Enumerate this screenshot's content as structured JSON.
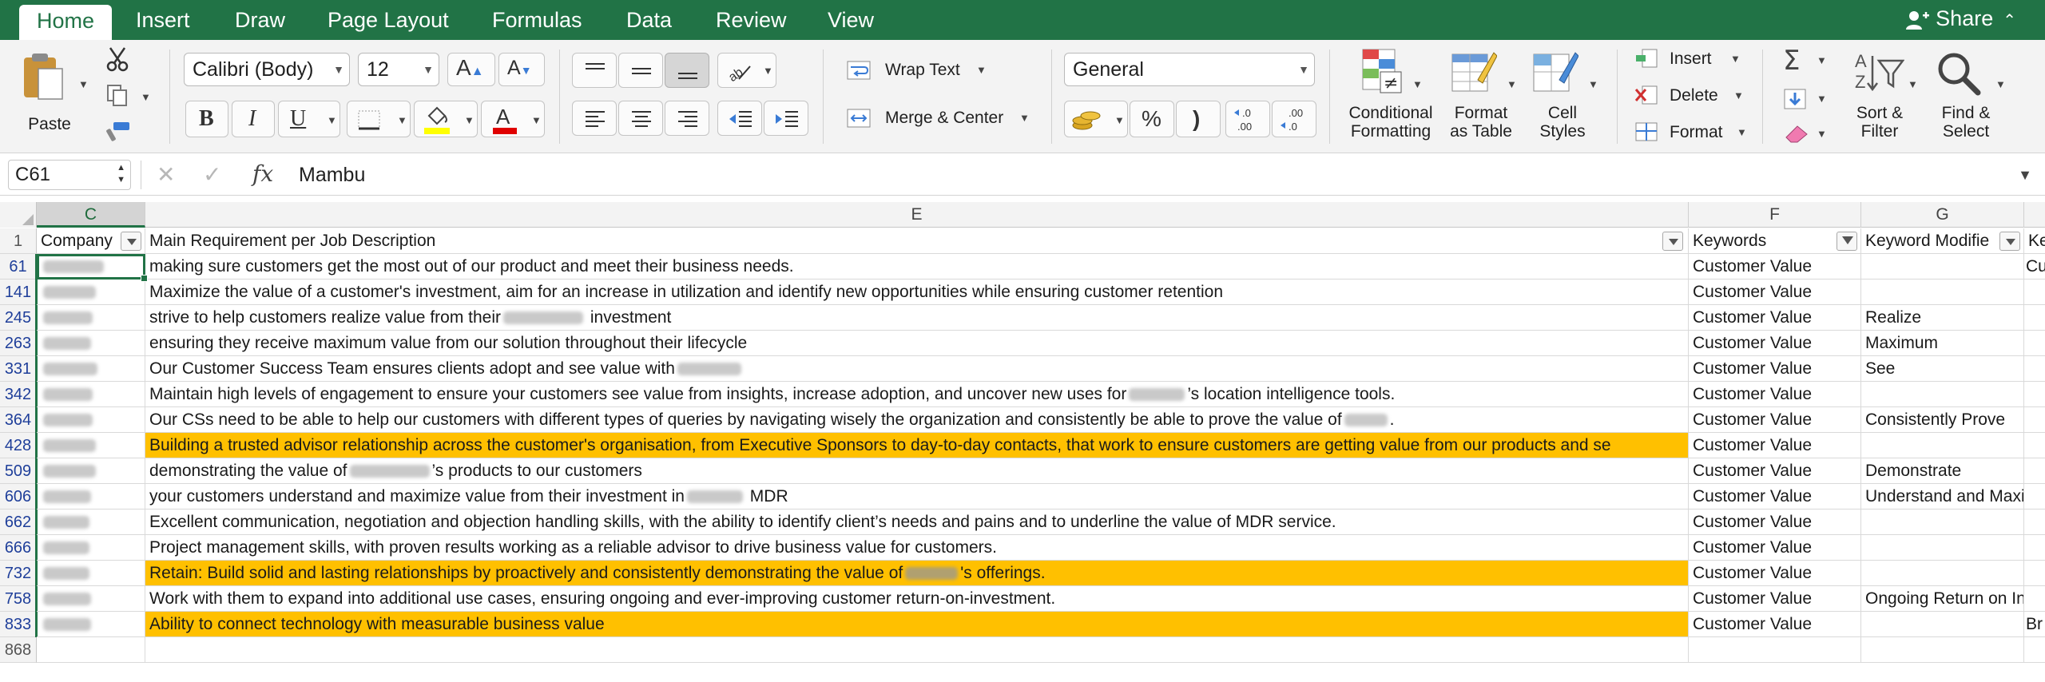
{
  "tabs": [
    {
      "label": "Home",
      "active": true
    },
    {
      "label": "Insert"
    },
    {
      "label": "Draw"
    },
    {
      "label": "Page Layout"
    },
    {
      "label": "Formulas"
    },
    {
      "label": "Data"
    },
    {
      "label": "Review"
    },
    {
      "label": "View"
    }
  ],
  "share_label": "Share",
  "ribbon": {
    "paste_label": "Paste",
    "font_name": "Calibri (Body)",
    "font_size": "12",
    "bold": "B",
    "italic": "I",
    "underline": "U",
    "wrap_text": "Wrap Text",
    "merge_center": "Merge & Center",
    "number_format": "General",
    "percent": "%",
    "comma": ")",
    "inc_decimal": ".0\n.00",
    "conditional_formatting": [
      "Conditional",
      "Formatting"
    ],
    "format_as_table": [
      "Format",
      "as Table"
    ],
    "cell_styles": [
      "Cell",
      "Styles"
    ],
    "insert": "Insert",
    "delete": "Delete",
    "format": "Format",
    "sort_filter": [
      "Sort &",
      "Filter"
    ],
    "find_select": [
      "Find &",
      "Select"
    ],
    "highlight_color": "#ffff00",
    "font_color": "#e00000"
  },
  "formula_bar": {
    "name_box": "C61",
    "fx": "fx",
    "content": "Mambu"
  },
  "columns": {
    "C": "C",
    "E": "E",
    "F": "F",
    "G": "G"
  },
  "headers": {
    "row_num": "1",
    "company": "Company",
    "requirement": "Main Requirement per Job Description",
    "keywords": "Keywords",
    "modifier": "Keyword Modifie",
    "next": "Ke"
  },
  "rows": [
    {
      "num": "61",
      "req_parts": [
        "making sure customers get the most out of our product and meet their business needs."
      ],
      "keywords": "Customer Value",
      "modifier": "",
      "next": "Cu",
      "highlight": false
    },
    {
      "num": "141",
      "req_parts": [
        "Maximize the value of a customer's investment, aim for an increase in utilization and identify new opportunities while ensuring customer retention"
      ],
      "keywords": "Customer Value",
      "modifier": "",
      "next": "",
      "highlight": false
    },
    {
      "num": "245",
      "req_parts": [
        "strive to help customers realize value from their",
        " investment"
      ],
      "keywords": "Customer Value",
      "modifier": "Realize",
      "next": "",
      "highlight": false
    },
    {
      "num": "263",
      "req_parts": [
        "ensuring they receive maximum value from our solution throughout their lifecycle"
      ],
      "keywords": "Customer Value",
      "modifier": "Maximum",
      "next": "",
      "highlight": false
    },
    {
      "num": "331",
      "req_parts": [
        "Our Customer Success Team ensures clients adopt and see value with",
        ""
      ],
      "keywords": "Customer Value",
      "modifier": "See",
      "next": "",
      "highlight": false
    },
    {
      "num": "342",
      "req_parts": [
        "Maintain high levels of engagement to ensure your customers see value from insights, increase adoption, and uncover new uses for",
        "’s location intelligence tools."
      ],
      "keywords": "Customer Value",
      "modifier": "",
      "next": "",
      "highlight": false
    },
    {
      "num": "364",
      "req_parts": [
        "Our CSs need to be able to help our customers with different types of queries by navigating wisely the organization and consistently be able to prove the value of",
        "."
      ],
      "keywords": "Customer Value",
      "modifier": "Consistently Prove",
      "next": "",
      "highlight": false
    },
    {
      "num": "428",
      "req_parts": [
        "Building a trusted advisor relationship across the customer's organisation, from Executive Sponsors to day-to-day contacts, that work to ensure customers are getting value from our products and se"
      ],
      "keywords": "Customer Value",
      "modifier": "",
      "next": "",
      "highlight": true
    },
    {
      "num": "509",
      "req_parts": [
        "demonstrating the value of",
        "’s products to our customers"
      ],
      "keywords": "Customer Value",
      "modifier": "Demonstrate",
      "next": "",
      "highlight": false
    },
    {
      "num": "606",
      "req_parts": [
        "your customers understand and maximize value from their investment in",
        " MDR"
      ],
      "keywords": "Customer Value",
      "modifier": "Understand and Maxim",
      "next": "",
      "highlight": false
    },
    {
      "num": "662",
      "req_parts": [
        "Excellent communication, negotiation and objection handling skills, with the ability to identify client’s needs and pains and to underline the value of MDR service."
      ],
      "keywords": "Customer Value",
      "modifier": "",
      "next": "",
      "highlight": false
    },
    {
      "num": "666",
      "req_parts": [
        "Project management skills, with proven results working as a reliable advisor to drive business value for customers."
      ],
      "keywords": "Customer Value",
      "modifier": "",
      "next": "",
      "highlight": false
    },
    {
      "num": "732",
      "req_parts": [
        "Retain: Build solid and lasting relationships by proactively and consistently demonstrating the value of",
        "'s offerings."
      ],
      "keywords": "Customer Value",
      "modifier": "",
      "next": "",
      "highlight": true
    },
    {
      "num": "758",
      "req_parts": [
        "Work with them to expand into additional use cases, ensuring ongoing and ever-improving customer return-on-investment."
      ],
      "keywords": "Customer Value",
      "modifier": "Ongoing Return on Inve",
      "next": "",
      "highlight": false
    },
    {
      "num": "833",
      "req_parts": [
        "Ability to connect technology with measurable business value"
      ],
      "keywords": "Customer Value",
      "modifier": "",
      "next": "Br",
      "highlight": true
    },
    {
      "num": "868",
      "req_parts": [
        ""
      ],
      "keywords": "",
      "modifier": "",
      "next": "",
      "highlight": false
    }
  ]
}
